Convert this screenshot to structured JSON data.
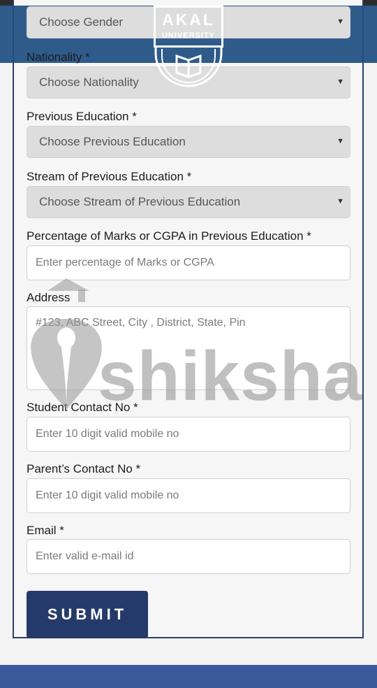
{
  "header": {
    "logo_title": "AKAL",
    "logo_subtitle": "UNIVERSITY",
    "brand_color": "#1f4f82"
  },
  "form": {
    "gender": {
      "placeholder": "Choose Gender"
    },
    "nationality": {
      "label": "Nationality *",
      "placeholder": "Choose Nationality"
    },
    "previous_education": {
      "label": "Previous Education *",
      "placeholder": "Choose Previous Education"
    },
    "stream": {
      "label": "Stream of Previous Education *",
      "placeholder": "Choose Stream of Previous Education"
    },
    "percentage": {
      "label": "Percentage of Marks or CGPA in Previous Education *",
      "placeholder": "Enter percentage of Marks or CGPA"
    },
    "address": {
      "label": "Address",
      "placeholder": "#123, ABC Street, City , District, State, Pin"
    },
    "student_contact": {
      "label": "Student Contact No *",
      "placeholder": "Enter 10 digit valid mobile no"
    },
    "parent_contact": {
      "label": "Parent’s Contact No *",
      "placeholder": "Enter 10 digit valid mobile no"
    },
    "email": {
      "label": "Email *",
      "placeholder": "Enter valid e-mail id"
    },
    "submit_label": "SUBMIT",
    "caret_icon": "dropdown-caret-icon"
  },
  "watermark": {
    "text": "shiksha"
  },
  "colors": {
    "submit_bg": "#253a6a",
    "footer_bg": "#3a5a9c",
    "select_bg": "#dddddd"
  }
}
